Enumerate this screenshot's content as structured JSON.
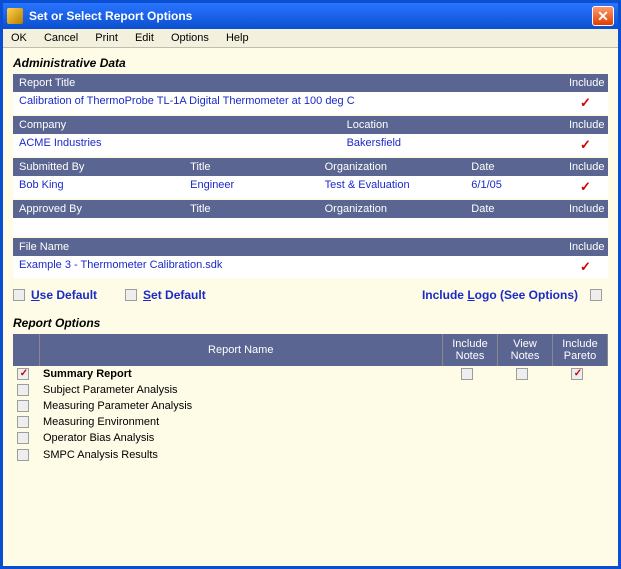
{
  "window": {
    "title": "Set or Select Report Options"
  },
  "menu": {
    "ok": "OK",
    "cancel": "Cancel",
    "print": "Print",
    "edit": "Edit",
    "options": "Options",
    "help": "Help"
  },
  "sections": {
    "admin": "Administrative Data",
    "report_options": "Report Options"
  },
  "headers": {
    "report_title": "Report Title",
    "include": "Include",
    "company": "Company",
    "location": "Location",
    "submitted_by": "Submitted By",
    "title": "Title",
    "organization": "Organization",
    "date": "Date",
    "approved_by": "Approved By",
    "file_name": "File Name"
  },
  "values": {
    "report_title": "Calibration of ThermoProbe TL-1A Digital Thermometer at 100 deg C",
    "company": "ACME Industries",
    "location": "Bakersfield",
    "submitted_by": "Bob King",
    "submitted_title": "Engineer",
    "submitted_org": "Test & Evaluation",
    "submitted_date": "6/1/05",
    "approved_by": "",
    "approved_title": "",
    "approved_org": "",
    "approved_date": "",
    "file_name": "Example 3 - Thermometer Calibration.sdk"
  },
  "include_marks": {
    "report_title": "✓",
    "company_location": "✓",
    "submitted": "✓",
    "approved": "",
    "file_name": "✓"
  },
  "opts": {
    "use_default_pre": "U",
    "use_default_rest": "se Default",
    "set_default_pre": "S",
    "set_default_rest": "et Default",
    "include_logo_pre": "Include ",
    "include_logo_u": "L",
    "include_logo_rest": "ogo (See Options)"
  },
  "report_table": {
    "cols": {
      "name": "Report Name",
      "inc_notes": "Include Notes",
      "view_notes": "View Notes",
      "inc_pareto": "Include Pareto"
    },
    "rows": [
      {
        "label": "Summary Report",
        "selected": true,
        "inc_notes": false,
        "view_notes": false,
        "inc_pareto": true,
        "bold": true
      },
      {
        "label": "Subject Parameter Analysis",
        "selected": false
      },
      {
        "label": "Measuring Parameter Analysis",
        "selected": false
      },
      {
        "label": "Measuring Environment",
        "selected": false
      },
      {
        "label": "Operator Bias Analysis",
        "selected": false
      },
      {
        "label": "SMPC Analysis Results",
        "selected": false
      }
    ]
  }
}
